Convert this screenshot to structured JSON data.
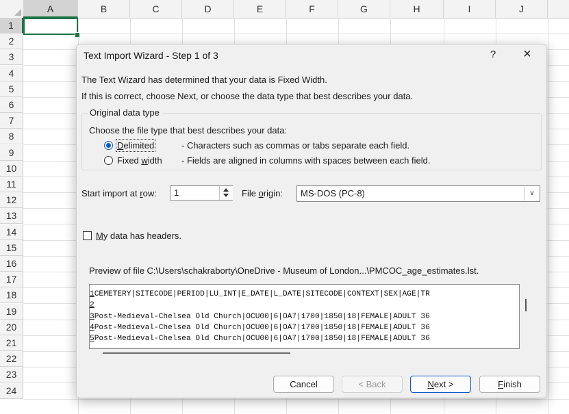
{
  "spreadsheet": {
    "columns": [
      "A",
      "B",
      "C",
      "D",
      "E",
      "F",
      "G",
      "H",
      "I",
      "J"
    ],
    "rows": [
      "1",
      "2",
      "3",
      "4",
      "5",
      "6",
      "7",
      "8",
      "9",
      "10",
      "11",
      "12",
      "13",
      "14",
      "15",
      "16",
      "17",
      "18",
      "19",
      "20",
      "21",
      "22",
      "23",
      "24"
    ],
    "active_cell": "A1",
    "accent_color": "#217346"
  },
  "dialog": {
    "title": "Text Import Wizard - Step 1 of 3",
    "help_icon": "?",
    "close_icon": "×",
    "line1": "The Text Wizard has determined that your data is Fixed Width.",
    "line2": "If this is correct, choose Next, or choose the data type that best describes your data.",
    "group_label": "Original data type",
    "choose_label": "Choose the file type that best describes your data:",
    "delimited": {
      "key": "D",
      "rest": "elimited",
      "description": "- Characters such as commas or tabs separate each field.",
      "checked": true
    },
    "fixed_width": {
      "pre": "Fixed ",
      "key": "w",
      "rest": "idth",
      "description": "- Fields are aligned in columns with spaces between each field.",
      "checked": false
    },
    "start_row": {
      "pre": "Start import at ",
      "key": "r",
      "rest": "ow:",
      "value": "1"
    },
    "file_origin": {
      "pre": "File ",
      "key": "o",
      "rest": "rigin:",
      "value": "MS-DOS (PC-8)"
    },
    "headers_checkbox": {
      "key": "M",
      "rest": "y data has headers.",
      "checked": false
    },
    "preview_label": "Preview of file C:\\Users\\schakraborty\\OneDrive - Museum of London...\\PMCOC_age_estimates.lst.",
    "preview_lines": [
      {
        "num": "1",
        "text": "CEMETERY|SITECODE|PERIOD|LU_INT|E_DATE|L_DATE|SITECODE|CONTEXT|SEX|AGE|TR"
      },
      {
        "num": "2",
        "text": ""
      },
      {
        "num": "3",
        "text": "Post-Medieval-Chelsea Old Church|OCU00|6|OA7|1700|1850|18|FEMALE|ADULT 36"
      },
      {
        "num": "4",
        "text": "Post-Medieval-Chelsea Old Church|OCU00|6|OA7|1700|1850|18|FEMALE|ADULT 36"
      },
      {
        "num": "5",
        "text": "Post-Medieval-Chelsea Old Church|OCU00|6|OA7|1700|1850|18|FEMALE|ADULT 36"
      }
    ],
    "buttons": {
      "cancel": "Cancel",
      "back": "< Back",
      "next_key": "N",
      "next_rest": "ext >",
      "finish_key": "F",
      "finish_rest": "inish"
    }
  }
}
